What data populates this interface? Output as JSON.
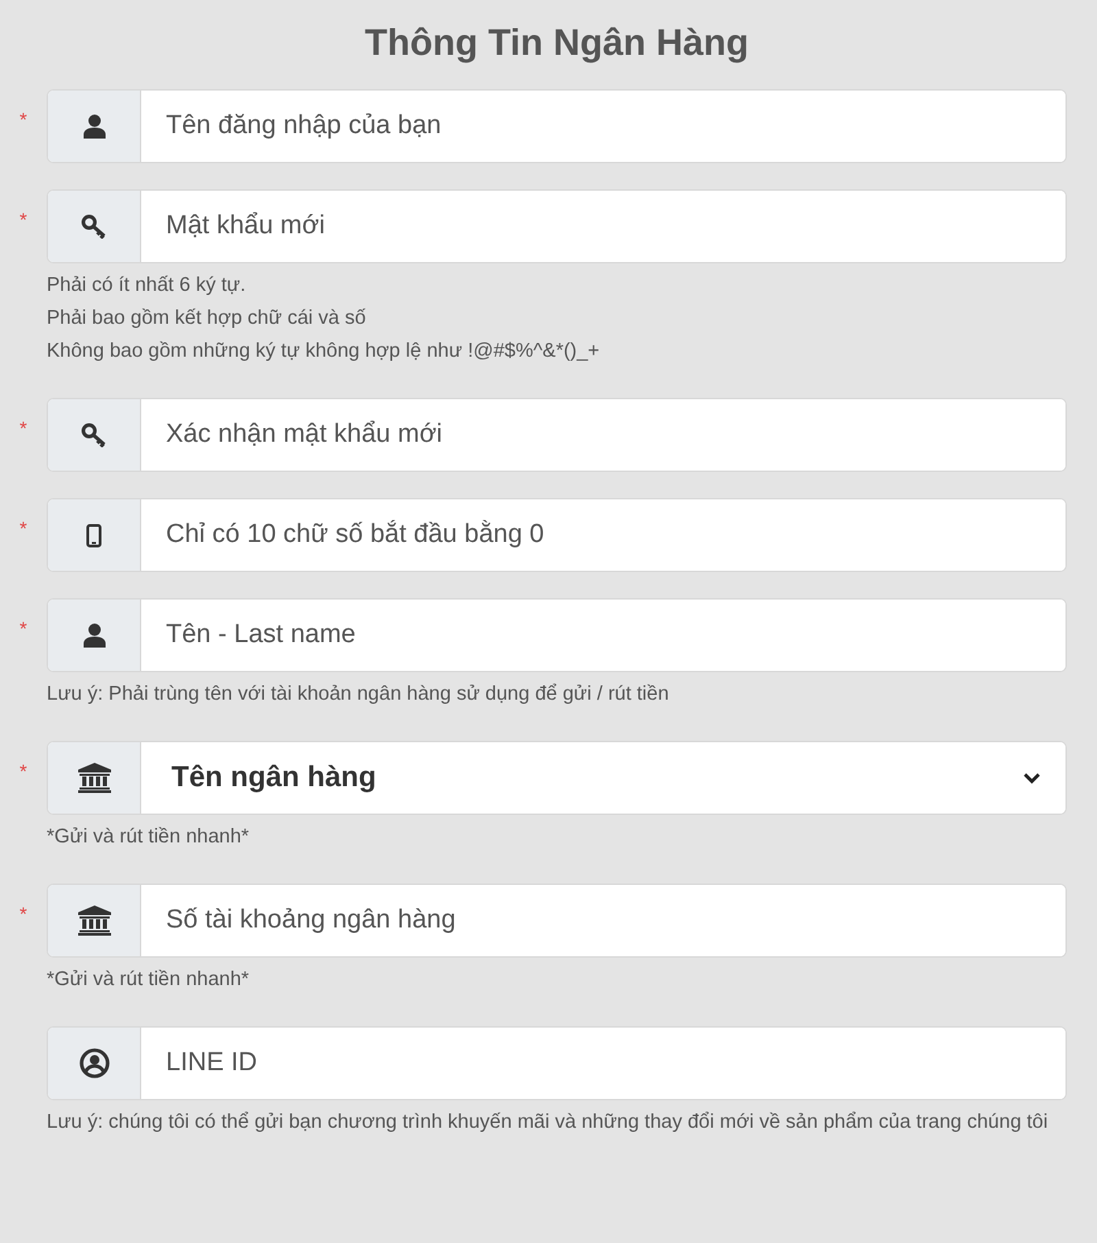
{
  "title": "Thông Tin Ngân Hàng",
  "fields": [
    {
      "kind": "input",
      "required_mark": "*",
      "placeholder": "Tên đăng nhập của bạn"
    },
    {
      "kind": "input",
      "required_mark": "*",
      "placeholder": "Mật khẩu mới",
      "notes": [
        "Phải có ít nhất 6 ký tự.",
        "Phải bao gồm kết hợp chữ cái và số",
        "Không bao gồm những ký tự không hợp lệ như !@#$%^&*()_+"
      ]
    },
    {
      "kind": "input",
      "required_mark": "*",
      "placeholder": "Xác nhận mật khẩu mới"
    },
    {
      "kind": "input",
      "required_mark": "*",
      "placeholder": "Chỉ có 10 chữ số bắt đầu bằng 0"
    },
    {
      "kind": "input",
      "required_mark": "*",
      "placeholder": "Tên - Last name",
      "notes": [
        "Lưu ý: Phải trùng tên với tài khoản ngân hàng sử dụng để gửi / rút tiền"
      ]
    },
    {
      "kind": "select",
      "required_mark": "*",
      "value": "Tên ngân hàng",
      "notes": [
        "*Gửi và rút tiền nhanh*"
      ]
    },
    {
      "kind": "input",
      "required_mark": "*",
      "placeholder": "Số tài khoảng ngân hàng",
      "notes": [
        "*Gửi và rút tiền nhanh*"
      ]
    },
    {
      "kind": "input",
      "placeholder": "LINE ID",
      "notes": [
        "Lưu ý: chúng tôi có thể gửi bạn chương trình khuyến mãi và những thay đổi mới về sản phẩm của trang chúng tôi"
      ]
    }
  ]
}
